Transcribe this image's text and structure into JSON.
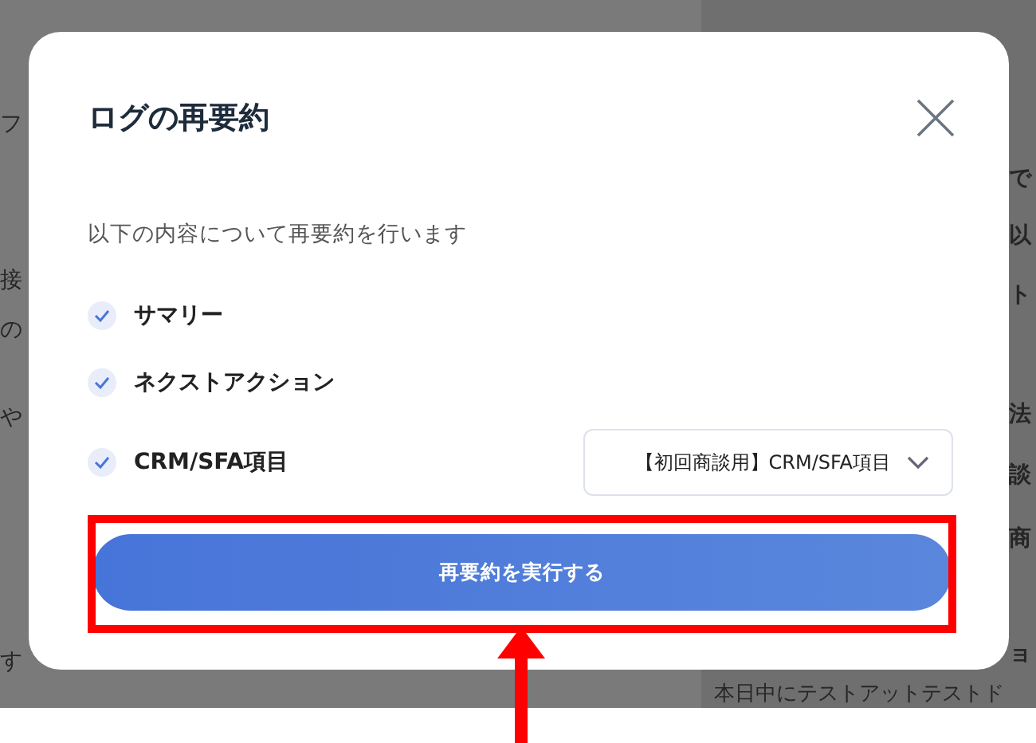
{
  "background": {
    "left_fragments": [
      "フ",
      "接",
      "の",
      "や",
      "す"
    ],
    "right_fragments": [
      "で",
      "以",
      "ト",
      "法",
      "談",
      "商",
      "ョ"
    ],
    "bottom_line": "本日中にテストアットテストド"
  },
  "dialog": {
    "title": "ログの再要約",
    "description": "以下の内容について再要約を行います",
    "options": [
      {
        "label": "サマリー",
        "checked": true,
        "kind": "plain"
      },
      {
        "label": "ネクストアクション",
        "checked": true,
        "kind": "plain"
      },
      {
        "label": "CRM/SFA項目",
        "checked": true,
        "kind": "select",
        "select_value": "【初回商談用】CRM/SFA項目"
      }
    ],
    "submit": "再要約を実行する"
  },
  "annotations": {
    "highlight": true,
    "arrow": true
  }
}
